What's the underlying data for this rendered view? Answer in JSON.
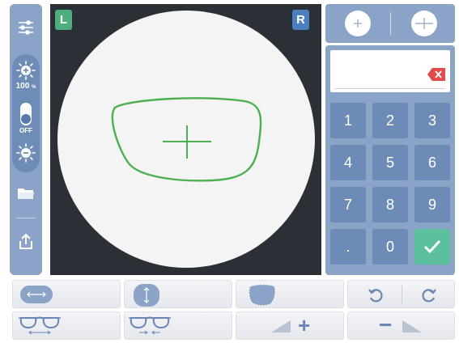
{
  "sidebar": {
    "brightness_percent": "100",
    "percent_unit": "%",
    "toggle_state": "OFF",
    "icons": [
      "settings-sliders-icon",
      "brightness-up-icon",
      "brightness-down-icon",
      "folder-icon",
      "export-icon"
    ]
  },
  "lens_view": {
    "left_tag": "L",
    "right_tag": "R",
    "colors": {
      "lens_outline": "#4caf50",
      "left_tag": "#4caf7d",
      "right_tag": "#4b7fbd",
      "background": "#2b2f36"
    }
  },
  "mode_bar": {
    "icons": [
      "small-target-icon",
      "large-target-icon"
    ]
  },
  "keypad": {
    "display_value": "",
    "keys": [
      "1",
      "2",
      "3",
      "4",
      "5",
      "6",
      "7",
      "8",
      "9",
      ".",
      "0"
    ],
    "colors": {
      "key": "#6e8bb7",
      "confirm": "#5cc09e",
      "backspace": "#e04b4b"
    }
  },
  "toolbar": {
    "icons": [
      "horizontal-shift-icon",
      "vertical-shift-icon",
      "lens-shape-icon",
      "undo-icon",
      "redo-icon",
      "glasses-widen-icon",
      "glasses-narrow-icon",
      "increase-size-icon",
      "decrease-size-icon"
    ],
    "plus_label": "+",
    "minus_label": "−"
  }
}
